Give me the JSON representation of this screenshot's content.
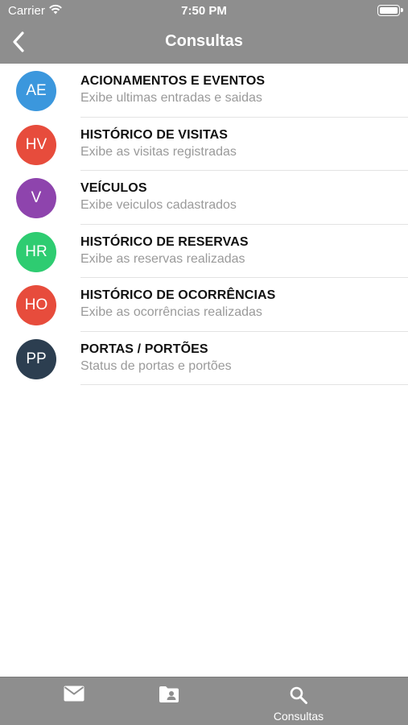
{
  "status_bar": {
    "carrier": "Carrier",
    "time": "7:50 PM",
    "wifi_icon": "wifi-icon",
    "battery_icon": "battery-icon"
  },
  "nav": {
    "back_icon": "chevron-left-icon",
    "title": "Consultas"
  },
  "colors": {
    "header_bg": "#8e8e8e",
    "tabbar_bg": "#8e8e8e"
  },
  "items": [
    {
      "initials": "AE",
      "title": "ACIONAMENTOS E EVENTOS",
      "subtitle": "Exibe ultimas entradas e saidas",
      "color": "#3b97dd"
    },
    {
      "initials": "HV",
      "title": "HISTÓRICO DE VISITAS",
      "subtitle": "Exibe as visitas registradas",
      "color": "#e74c3c"
    },
    {
      "initials": "V",
      "title": "VEÍCULOS",
      "subtitle": "Exibe veiculos cadastrados",
      "color": "#8e44ad"
    },
    {
      "initials": "HR",
      "title": "HISTÓRICO DE RESERVAS",
      "subtitle": "Exibe as reservas realizadas",
      "color": "#2ecc71"
    },
    {
      "initials": "HO",
      "title": "HISTÓRICO DE OCORRÊNCIAS",
      "subtitle": "Exibe as ocorrências realizadas",
      "color": "#e74c3c"
    },
    {
      "initials": "PP",
      "title": "PORTAS / PORTÕES",
      "subtitle": "Status de portas e portões",
      "color": "#2c3e50"
    }
  ],
  "tabbar": {
    "tabs": [
      {
        "icon": "mail-icon",
        "label": ""
      },
      {
        "icon": "contact-folder-icon",
        "label": ""
      },
      {
        "icon": "search-icon",
        "label": "Consultas"
      }
    ]
  }
}
